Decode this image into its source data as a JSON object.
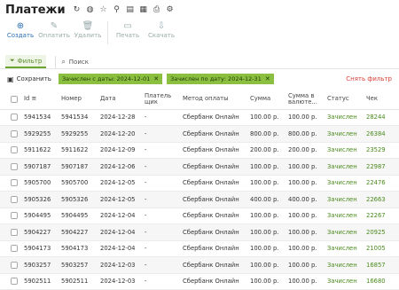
{
  "title": "Платежи",
  "toolbar": {
    "create": "Создать",
    "pay": "Оплатить",
    "delete": "Удалить",
    "print": "Печать",
    "download": "Скачать"
  },
  "filter": {
    "button": "Фильтр",
    "search_placeholder": "Поиск"
  },
  "tags": {
    "save": "Сохранить",
    "from": "Зачислен с даты: 2024-12-01",
    "to": "Зачислен по дату: 2024-12-31",
    "clear": "Снять фильтр"
  },
  "columns": [
    "Id",
    "Номер",
    "Дата",
    "Плательщик",
    "Метод оплаты",
    "Сумма",
    "Сумма в валюте...",
    "Статус",
    "Чек"
  ],
  "rows": [
    {
      "id": "5941534",
      "num": "5941534",
      "date": "2024-12-28",
      "payer": "-",
      "method": "Сбербанк Онлайн",
      "sum": "100.00 р.",
      "cur": "100.00 р.",
      "status": "Зачислен",
      "check": "28244"
    },
    {
      "id": "5929255",
      "num": "5929255",
      "date": "2024-12-20",
      "payer": "-",
      "method": "Сбербанк Онлайн",
      "sum": "800.00 р.",
      "cur": "800.00 р.",
      "status": "Зачислен",
      "check": "26384"
    },
    {
      "id": "5911622",
      "num": "5911622",
      "date": "2024-12-09",
      "payer": "-",
      "method": "Сбербанк Онлайн",
      "sum": "200.00 р.",
      "cur": "200.00 р.",
      "status": "Зачислен",
      "check": "23529"
    },
    {
      "id": "5907187",
      "num": "5907187",
      "date": "2024-12-06",
      "payer": "-",
      "method": "Сбербанк Онлайн",
      "sum": "100.00 р.",
      "cur": "100.00 р.",
      "status": "Зачислен",
      "check": "22987"
    },
    {
      "id": "5905700",
      "num": "5905700",
      "date": "2024-12-05",
      "payer": "-",
      "method": "Сбербанк Онлайн",
      "sum": "100.00 р.",
      "cur": "100.00 р.",
      "status": "Зачислен",
      "check": "22476"
    },
    {
      "id": "5905326",
      "num": "5905326",
      "date": "2024-12-05",
      "payer": "-",
      "method": "Сбербанк Онлайн",
      "sum": "400.00 р.",
      "cur": "400.00 р.",
      "status": "Зачислен",
      "check": "22663"
    },
    {
      "id": "5904495",
      "num": "5904495",
      "date": "2024-12-04",
      "payer": "-",
      "method": "Сбербанк Онлайн",
      "sum": "100.00 р.",
      "cur": "100.00 р.",
      "status": "Зачислен",
      "check": "22267"
    },
    {
      "id": "5904227",
      "num": "5904227",
      "date": "2024-12-04",
      "payer": "-",
      "method": "Сбербанк Онлайн",
      "sum": "100.00 р.",
      "cur": "100.00 р.",
      "status": "Зачислен",
      "check": "20925"
    },
    {
      "id": "5904173",
      "num": "5904173",
      "date": "2024-12-04",
      "payer": "-",
      "method": "Сбербанк Онлайн",
      "sum": "100.00 р.",
      "cur": "100.00 р.",
      "status": "Зачислен",
      "check": "21005"
    },
    {
      "id": "5903257",
      "num": "5903257",
      "date": "2024-12-03",
      "payer": "-",
      "method": "Сбербанк Онлайн",
      "sum": "100.00 р.",
      "cur": "100.00 р.",
      "status": "Зачислен",
      "check": "16857"
    },
    {
      "id": "5902511",
      "num": "5902511",
      "date": "2024-12-03",
      "payer": "-",
      "method": "Сбербанк Онлайн",
      "sum": "100.00 р.",
      "cur": "100.00 р.",
      "status": "Зачислен",
      "check": "16680"
    }
  ]
}
